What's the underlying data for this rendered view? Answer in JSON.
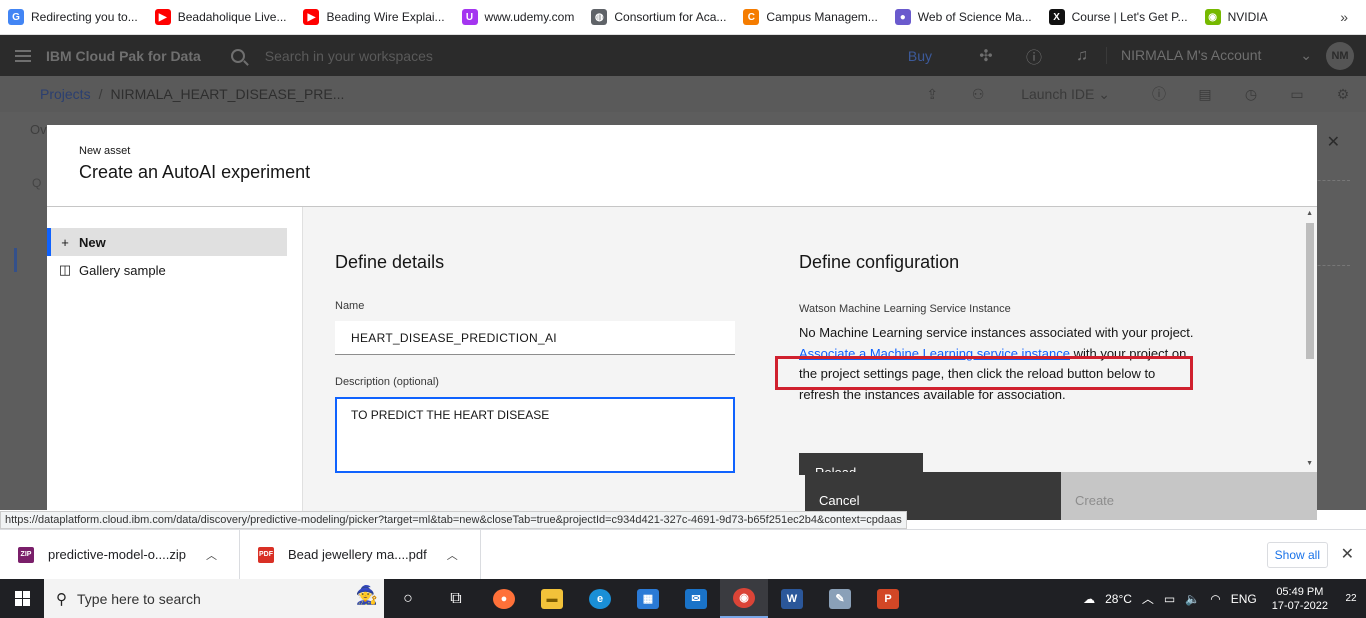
{
  "bookmarks": [
    {
      "label": "Redirecting you to...",
      "icon": "google-icon",
      "color": "#4285f4",
      "glyph": "G"
    },
    {
      "label": "Beadaholique Live...",
      "icon": "youtube-icon",
      "color": "#ff0000",
      "glyph": "▶"
    },
    {
      "label": "Beading Wire Explai...",
      "icon": "youtube-icon",
      "color": "#ff0000",
      "glyph": "▶"
    },
    {
      "label": "www.udemy.com",
      "icon": "udemy-icon",
      "color": "#a435f0",
      "glyph": "U"
    },
    {
      "label": "Consortium for Aca...",
      "icon": "globe-icon",
      "color": "#5f6368",
      "glyph": "◍"
    },
    {
      "label": "Campus Managem...",
      "icon": "campus-icon",
      "color": "#f57c00",
      "glyph": "C"
    },
    {
      "label": "Web of Science Ma...",
      "icon": "wos-icon",
      "color": "#6a5acd",
      "glyph": "●"
    },
    {
      "label": "Course | Let's Get P...",
      "icon": "course-icon",
      "color": "#111111",
      "glyph": "X"
    },
    {
      "label": "NVIDIA",
      "icon": "nvidia-icon",
      "color": "#76b900",
      "glyph": "◉"
    }
  ],
  "header": {
    "brand": "IBM Cloud Pak for Data",
    "search_placeholder": "Search in your workspaces",
    "buy": "Buy",
    "account": "NIRMALA M's Account",
    "avatar": "NM"
  },
  "breadcrumb": {
    "link": "Projects",
    "sep": "/",
    "current": "NIRMALA_HEART_DISEASE_PRE...",
    "launch": "Launch IDE"
  },
  "background": {
    "tab": "Ov",
    "field": "Q"
  },
  "modal": {
    "label": "New asset",
    "title": "Create an AutoAI experiment",
    "nav": {
      "new": "New",
      "gallery": "Gallery sample"
    },
    "details": {
      "title": "Define details",
      "name_label": "Name",
      "name_value": "HEART_DISEASE_PREDICTION_AI",
      "desc_label": "Description (optional)",
      "desc_value": "TO PREDICT THE HEART DISEASE"
    },
    "config": {
      "title": "Define configuration",
      "label": "Watson Machine Learning Service Instance",
      "text1": "No Machine Learning service instances associated with your project.",
      "link": "Associate a Machine Learning service instance",
      "text2": " with your project on the project settings page, then click the reload button below to refresh the instances available for association.",
      "reload": "Reload"
    },
    "cancel": "Cancel",
    "create": "Create"
  },
  "status_url": "https://dataplatform.cloud.ibm.com/data/discovery/predictive-modeling/picker?target=ml&tab=new&closeTab=true&projectId=c934d421-327c-4691-9d73-b65f251ec2b4&context=cpdaas",
  "downloads": {
    "items": [
      {
        "name": "predictive-model-o....zip",
        "color": "#7a1f6a",
        "glyph": "ZIP"
      },
      {
        "name": "Bead jewellery ma....pdf",
        "color": "#d93025",
        "glyph": "PDF"
      }
    ],
    "show_all": "Show all"
  },
  "taskbar": {
    "search": "Type here to search",
    "weather": "28°C",
    "lang": "ENG",
    "time": "05:49 PM",
    "date": "17-07-2022",
    "notifications": "22"
  }
}
